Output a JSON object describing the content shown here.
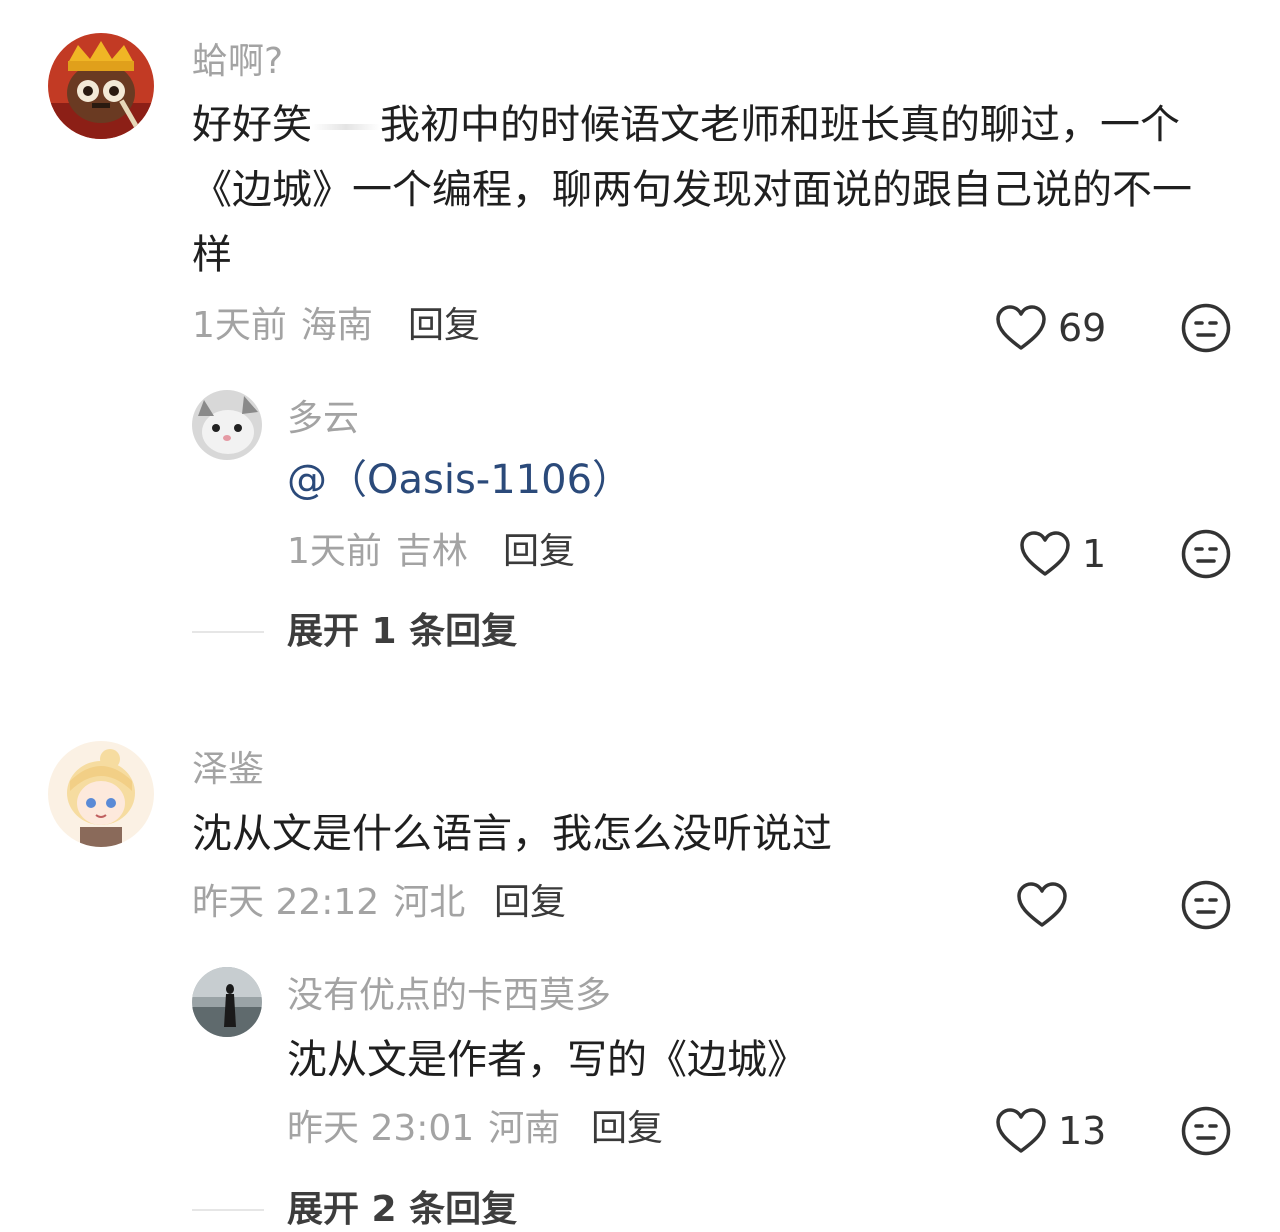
{
  "comments": [
    {
      "username": "蛤啊?",
      "text_line1_a": "好好笑",
      "text_line1_b": "我初中的时候语文老师和班长真的聊过，一个",
      "text_line2": "《边城》一个编程，聊两句发现对面说的跟自己说的不一",
      "text_line3": "样",
      "time": "1天前",
      "location": "海南",
      "reply_label": "回复",
      "likes": "69",
      "replies": [
        {
          "username": "多云",
          "mention": "@（Oasis-1106）",
          "time": "1天前",
          "location": "吉林",
          "reply_label": "回复",
          "likes": "1"
        }
      ],
      "expand_label": "展开 1 条回复"
    },
    {
      "username": "泽鉴",
      "text": "沈从文是什么语言，我怎么没听说过",
      "time": "昨天 22:12",
      "location": "河北",
      "reply_label": "回复",
      "likes": "",
      "replies": [
        {
          "username": "没有优点的卡西莫多",
          "text": "沈从文是作者，写的《边城》",
          "time": "昨天 23:01",
          "location": "河南",
          "reply_label": "回复",
          "likes": "13"
        }
      ],
      "expand_label": "展开 2 条回复"
    }
  ],
  "icons": {
    "like": "heart-outline-icon",
    "emoji": "neutral-face-icon"
  },
  "colors": {
    "username": "#a3a3a3",
    "text": "#1f1f1f",
    "mention": "#2b4a7a",
    "icon": "#333333"
  }
}
